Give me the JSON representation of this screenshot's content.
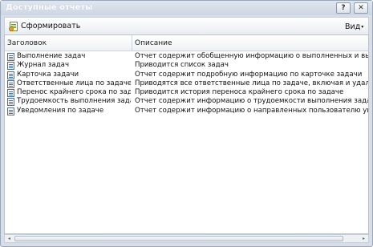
{
  "window": {
    "title": "Доступные отчеты",
    "help_label": "?",
    "close_label": "✕"
  },
  "toolbar": {
    "generate_label": "Сформировать",
    "view_label": "Вид",
    "view_caret": "▾"
  },
  "grid": {
    "columns": [
      "Заголовок",
      "Описание"
    ],
    "rows": [
      {
        "title": "Выполнение задач",
        "description": "Отчет содержит обобщенную информацию о выполненных и выполняемых задачах"
      },
      {
        "title": "Журнал задач",
        "description": "Приводится список задач"
      },
      {
        "title": "Карточка задачи",
        "description": "Отчет содержит подробную информацию по карточке задачи"
      },
      {
        "title": "Ответственные лица по задаче",
        "description": "Приводятся все ответственные лица по задаче, включая и удаленных (з"
      },
      {
        "title": "Перенос крайнего срока по задаче",
        "description": "Приводится история переноса крайнего срока по задаче"
      },
      {
        "title": "Трудоемкость выполнения задачи",
        "description": "Отчет содержит информацию о трудоемкости выполнения задачи ответс"
      },
      {
        "title": "Уведомления по задаче",
        "description": "Отчет содержит информацию о направленных пользователю уведомлениях"
      }
    ]
  },
  "scrollbar": {
    "left_arrow": "◂",
    "right_arrow": "▸"
  }
}
